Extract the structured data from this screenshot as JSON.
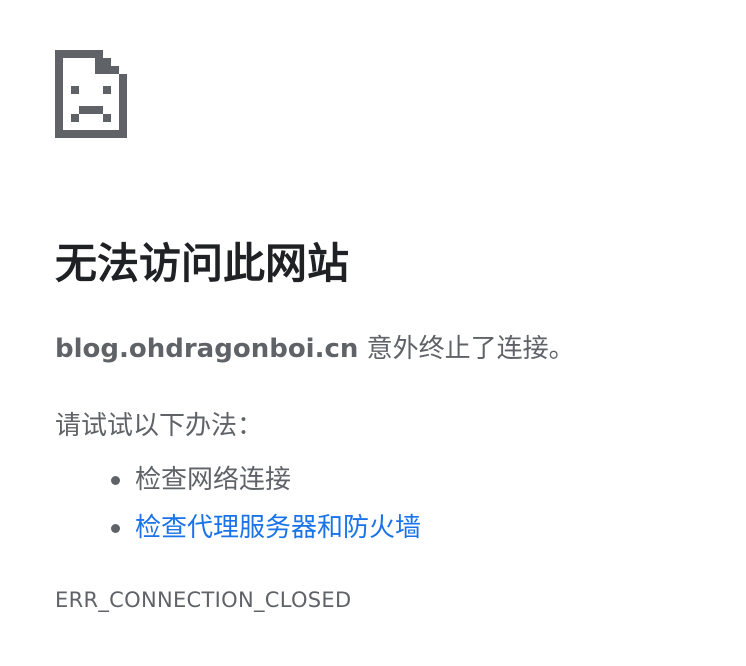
{
  "icon": "sad-page-icon",
  "title": "无法访问此网站",
  "message": {
    "host": "blog.ohdragonboi.cn",
    "text": " 意外终止了连接。"
  },
  "suggestions": {
    "heading": "请试试以下办法：",
    "items": [
      {
        "label": "检查网络连接",
        "is_link": false
      },
      {
        "label": "检查代理服务器和防火墙",
        "is_link": true
      }
    ]
  },
  "error_code": "ERR_CONNECTION_CLOSED",
  "colors": {
    "title": "#202124",
    "body_text": "#5f6368",
    "link": "#1a73e8",
    "icon": "#5f6368"
  }
}
